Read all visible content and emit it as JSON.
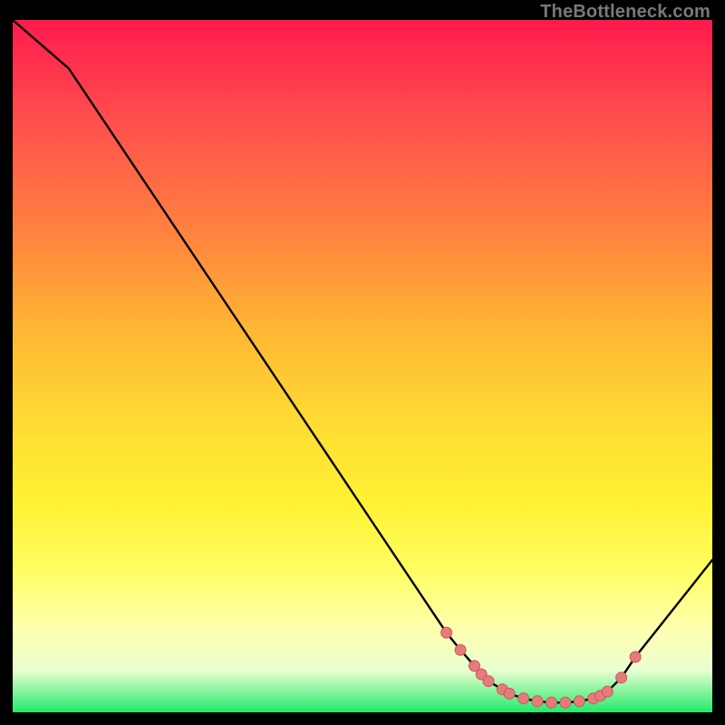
{
  "attribution": "TheBottleneck.com",
  "colors": {
    "gradient_top": "#ff1a4d",
    "gradient_bottom": "#22e96b",
    "curve": "#000000",
    "marker_fill": "#e77a7a",
    "marker_stroke": "#c95858"
  },
  "chart_data": {
    "type": "line",
    "title": "",
    "xlabel": "",
    "ylabel": "",
    "xlim": [
      0,
      100
    ],
    "ylim": [
      0,
      100
    ],
    "x_normalized": [
      0,
      8,
      60,
      62,
      64,
      66,
      67,
      68,
      70,
      71,
      73,
      75,
      77,
      79,
      81,
      83,
      84,
      85,
      87,
      89,
      100
    ],
    "y_normalized": [
      100,
      93,
      14.5,
      11.5,
      9,
      6.7,
      5.5,
      4.5,
      3.3,
      2.7,
      2.0,
      1.6,
      1.4,
      1.4,
      1.6,
      2.0,
      2.4,
      3.0,
      5.0,
      8.0,
      22
    ],
    "marker_indices": [
      3,
      4,
      5,
      6,
      7,
      8,
      9,
      10,
      11,
      12,
      13,
      14,
      15,
      16,
      17,
      18,
      19
    ],
    "notes": "Axes unlabeled in source; values are normalized 0–100 from plot pixel positions."
  }
}
